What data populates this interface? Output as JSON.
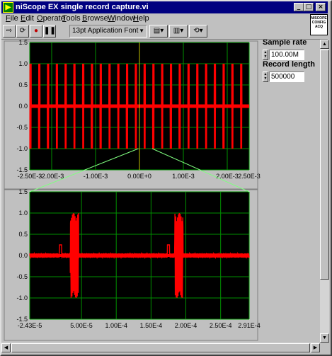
{
  "window": {
    "title": "niScope EX single record capture.vi",
    "controls": {
      "minimize": "_",
      "maximize": "□",
      "close": "×"
    }
  },
  "menubar": {
    "items": [
      {
        "label": "File",
        "key": "F",
        "rest": "ile"
      },
      {
        "label": "Edit",
        "key": "E",
        "rest": "dit"
      },
      {
        "label": "Operate",
        "key": "O",
        "rest": "perate"
      },
      {
        "label": "Tools",
        "key": "T",
        "rest": "ools"
      },
      {
        "label": "Browse",
        "key": "B",
        "rest": "rowse"
      },
      {
        "label": "Window",
        "key": "W",
        "rest": "indow"
      },
      {
        "label": "Help",
        "key": "H",
        "rest": "elp"
      }
    ]
  },
  "toolbar": {
    "font_select": "13pt Application Font",
    "icons": [
      "run-arrow-icon",
      "run-continuously-icon",
      "abort-icon",
      "pause-icon",
      "align-icon",
      "distribute-icon",
      "reorder-icon"
    ]
  },
  "badge": {
    "lines": [
      "NISCOPE",
      "CONFIG",
      "ACQ"
    ]
  },
  "sample_rate": {
    "label": "Sample rate",
    "value": "100.00M"
  },
  "record_length": {
    "label": "Record length",
    "value": "500000"
  },
  "colors": {
    "plot_bg": "#000000",
    "grid": "#009000",
    "trace": "#ff0000",
    "zoom_lines": "#80ff80"
  },
  "chart_data": [
    {
      "type": "line",
      "title": "",
      "x_ticks": [
        "-2.50E-3",
        "-2.00E-3",
        "-1.00E-3",
        "0.00E+0",
        "1.00E-3",
        "2.00E-3",
        "2.50E-3"
      ],
      "x_tick_values": [
        -0.0025,
        -0.002,
        -0.001,
        0,
        0.001,
        0.002,
        0.0025
      ],
      "y_ticks": [
        "1.5",
        "1.0",
        "0.5",
        "0.0",
        "-0.5",
        "-1.0",
        "-1.5"
      ],
      "y_tick_values": [
        1.5,
        1.0,
        0.5,
        0.0,
        -0.5,
        -1.0,
        -1.5
      ],
      "xlim": [
        -0.0025,
        0.0025
      ],
      "ylim": [
        -1.5,
        1.5
      ],
      "grid": true,
      "series": [
        {
          "values_description_free": true,
          "baseline": 0.0,
          "burst_amplitude": 1.0,
          "burst_period": 0.0002,
          "burst_start": -0.0025
        }
      ]
    },
    {
      "type": "line",
      "title": "",
      "x_ticks": [
        "-2.43E-5",
        "5.00E-5",
        "1.00E-4",
        "1.50E-4",
        "2.00E-4",
        "2.50E-4",
        "2.91E-4"
      ],
      "x_tick_values": [
        -2.43e-05,
        5e-05,
        0.0001,
        0.00015,
        0.0002,
        0.00025,
        0.000291
      ],
      "y_ticks": [
        "1.5",
        "1.0",
        "0.5",
        "0.0",
        "-0.5",
        "-1.0",
        "-1.5"
      ],
      "y_tick_values": [
        1.5,
        1.0,
        0.5,
        0.0,
        -0.5,
        -1.0,
        -1.5
      ],
      "xlim": [
        -2.43e-05,
        0.000291
      ],
      "ylim": [
        -1.5,
        1.5
      ],
      "grid": true,
      "series": [
        {
          "baseline": 0.0,
          "bursts_at": [
            4e-05,
            0.00019
          ],
          "burst_amplitude": 1.0,
          "spikes_at": [
            2e-05,
            0.000175
          ],
          "spike_value": 0.25
        }
      ]
    }
  ]
}
